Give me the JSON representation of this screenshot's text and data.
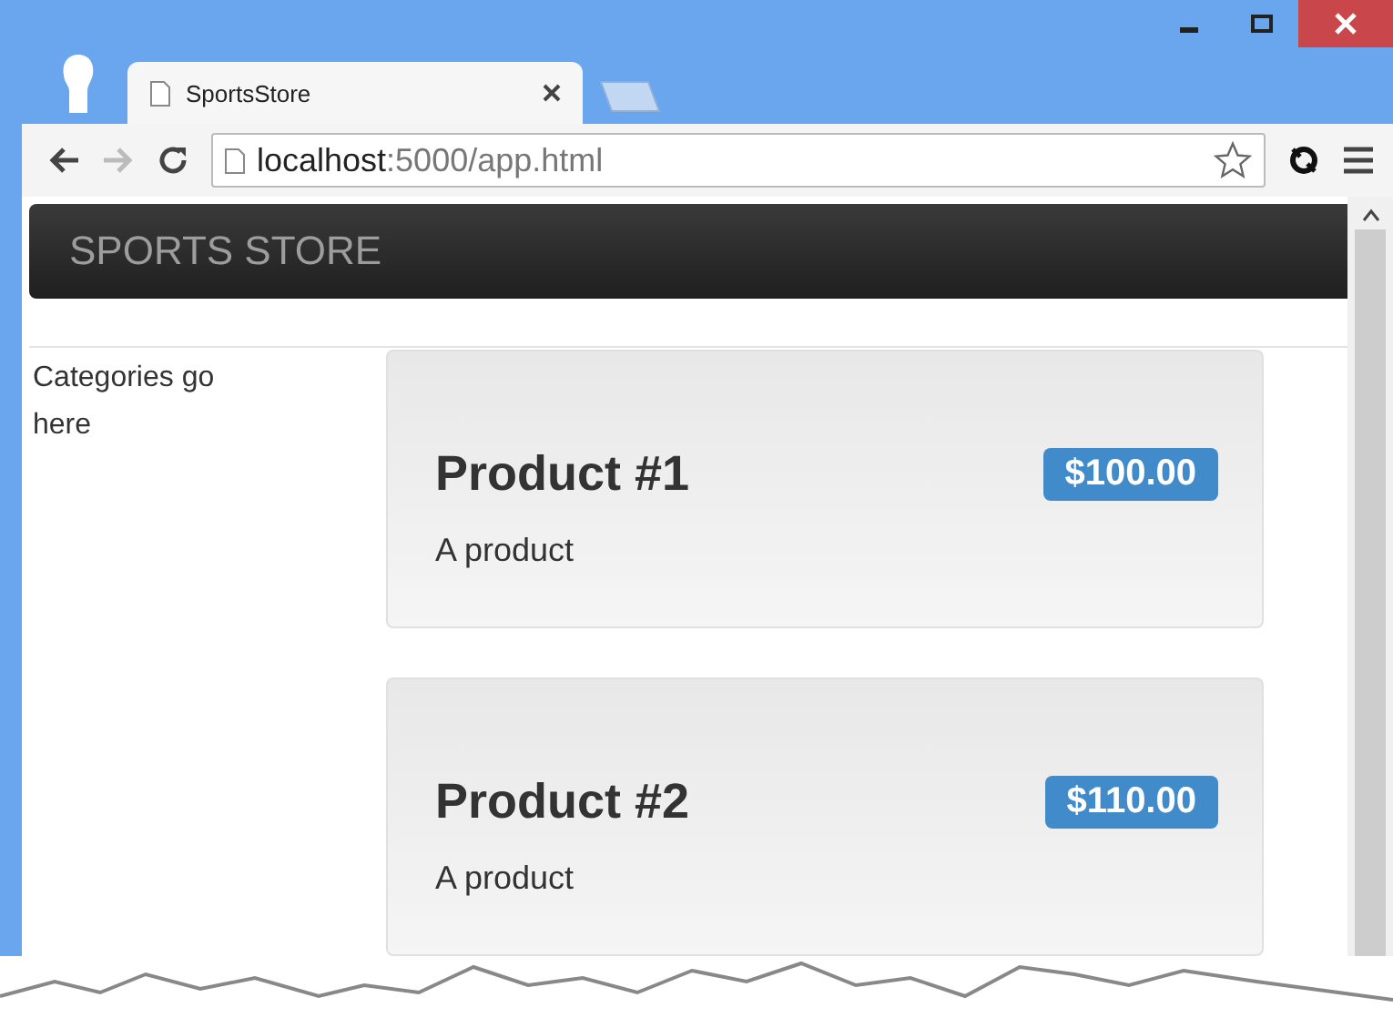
{
  "browser": {
    "tab_title": "SportsStore",
    "address_host": "localhost",
    "address_path": ":5000/app.html"
  },
  "navbar": {
    "brand": "SPORTS STORE"
  },
  "sidebar": {
    "text": "Categories go here"
  },
  "products": [
    {
      "name": "Product #1",
      "price": "$100.00",
      "description": "A product"
    },
    {
      "name": "Product #2",
      "price": "$110.00",
      "description": "A product"
    }
  ]
}
